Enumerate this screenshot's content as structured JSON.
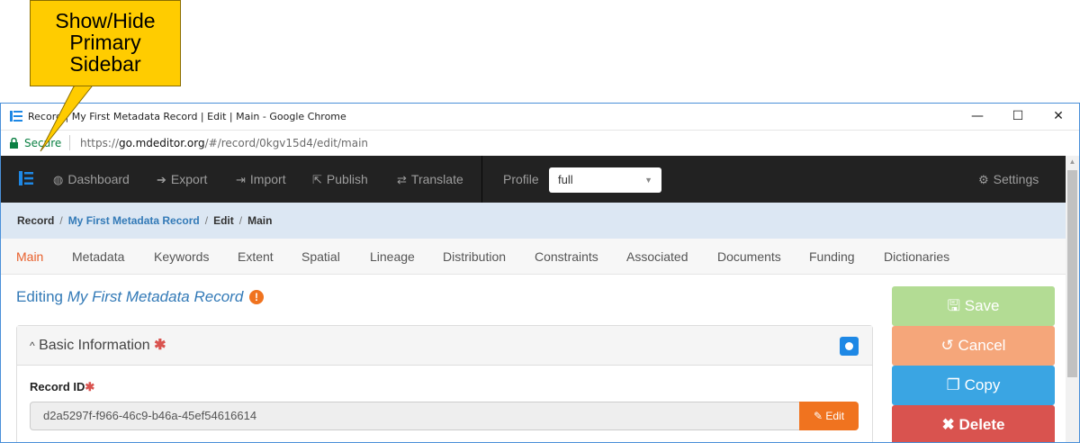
{
  "callout": {
    "lines": [
      "Show/Hide",
      "Primary",
      "Sidebar"
    ],
    "color": "#ffcc00"
  },
  "window": {
    "title": "Record | My First Metadata Record | Edit | Main - Google Chrome",
    "minimize_glyph": "—",
    "maximize_glyph": "☐",
    "close_glyph": "✕"
  },
  "address": {
    "secure_label": "Secure",
    "url_scheme": "https://",
    "url_host": "go.mdeditor.org",
    "url_path": "/#/record/0kgv15d4/edit/main"
  },
  "navbar": {
    "toggle_icon": "sidebar-toggle-icon",
    "items": [
      {
        "label": "Dashboard",
        "icon": "tachometer-icon"
      },
      {
        "label": "Export",
        "icon": "export-icon"
      },
      {
        "label": "Import",
        "icon": "import-icon"
      },
      {
        "label": "Publish",
        "icon": "publish-icon"
      },
      {
        "label": "Translate",
        "icon": "translate-icon"
      }
    ],
    "profile_label": "Profile",
    "profile_value": "full",
    "settings_label": "Settings"
  },
  "breadcrumb": {
    "root": "Record",
    "record": "My First Metadata Record",
    "edit": "Edit",
    "current": "Main"
  },
  "tabs": [
    {
      "label": "Main",
      "active": true
    },
    {
      "label": "Metadata"
    },
    {
      "label": "Keywords"
    },
    {
      "label": "Extent"
    },
    {
      "label": "Spatial"
    },
    {
      "label": "Lineage"
    },
    {
      "label": "Distribution"
    },
    {
      "label": "Constraints"
    },
    {
      "label": "Associated"
    },
    {
      "label": "Documents"
    },
    {
      "label": "Funding"
    },
    {
      "label": "Dictionaries"
    }
  ],
  "main": {
    "editing_prefix": "Editing",
    "record_name": "My First Metadata Record",
    "warning_glyph": "!",
    "panel_title": "Basic Information",
    "required_mark": "✱",
    "field_label": "Record ID",
    "record_id": "d2a5297f-f966-46c9-b46a-45ef54616614",
    "edit_label": "Edit"
  },
  "actions": {
    "save": "Save",
    "cancel": "Cancel",
    "copy": "Copy",
    "delete": "Delete"
  },
  "colors": {
    "accent": "#e8602c",
    "link": "#337ab7",
    "navbar": "#222222",
    "save": "#b3dc94",
    "cancel": "#f5a67a",
    "copy": "#3aa5e3",
    "delete": "#d9534f"
  }
}
